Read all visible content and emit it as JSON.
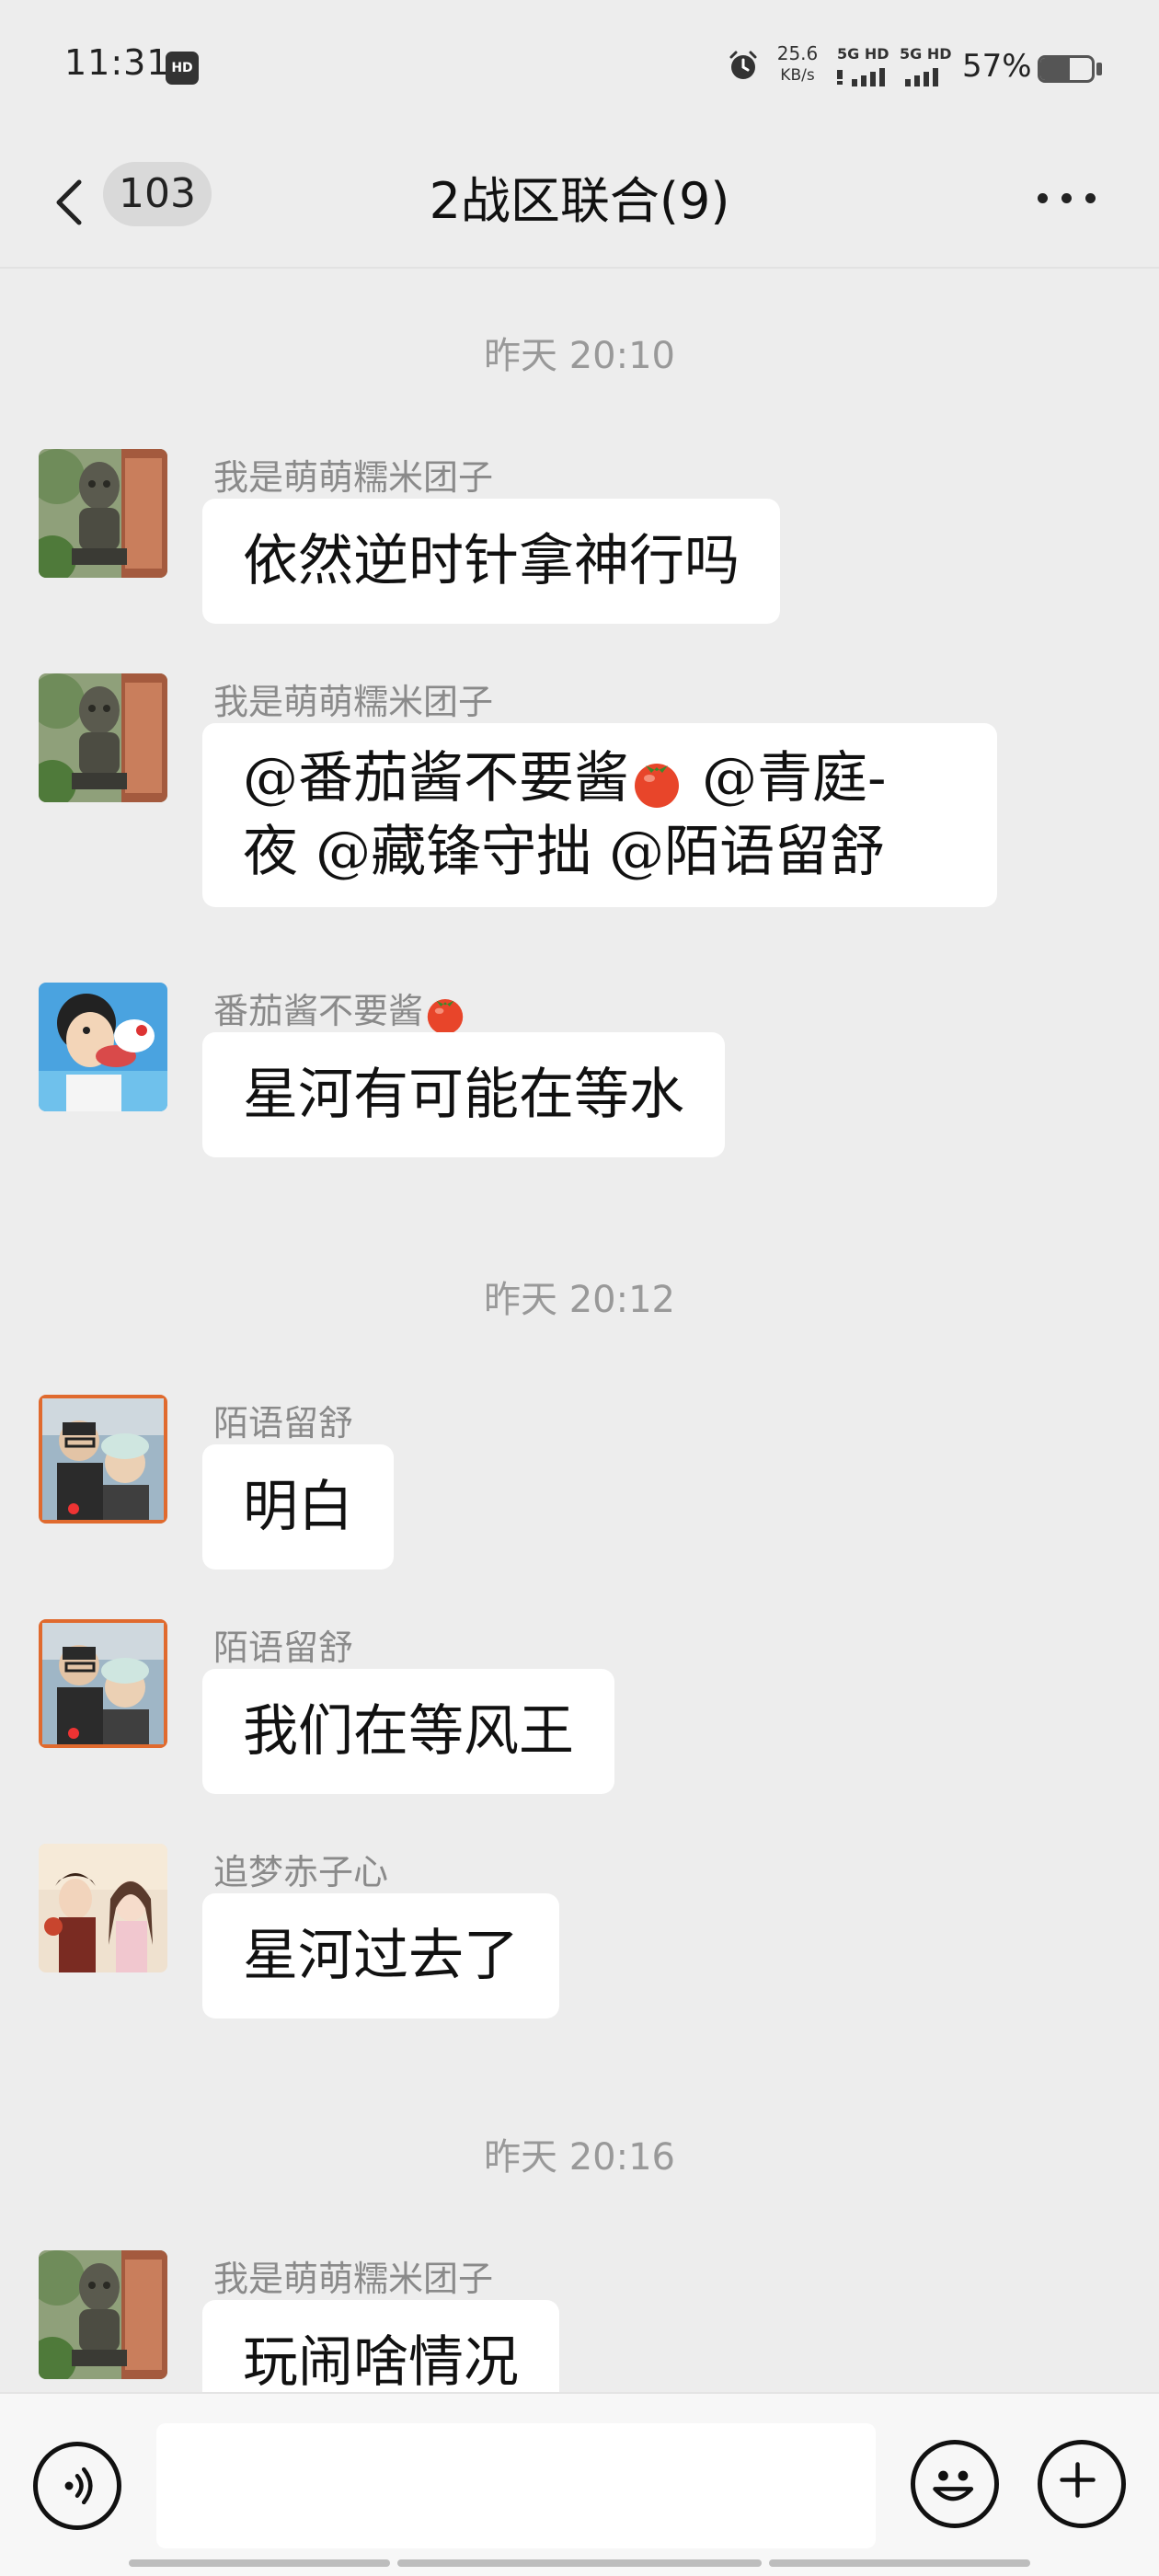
{
  "status_bar": {
    "time": "11:31",
    "net_speed": "25.6",
    "net_unit": "KB/s",
    "sim1": "5G HD",
    "sim2": "5G HD",
    "battery_percent": "57%",
    "battery_level": 0.57
  },
  "header": {
    "unread_count": "103",
    "title": "2战区联合(9)"
  },
  "messages": [
    {
      "type": "time",
      "text": "昨天 20:10"
    },
    {
      "type": "msg",
      "sender": "我是萌萌糯米团子",
      "text": "依然逆时针拿神行吗",
      "avatar": "statue"
    },
    {
      "type": "msg",
      "sender": "我是萌萌糯米团子",
      "line1": "@番茄酱不要酱",
      "line1b": " @青庭-",
      "line2": "夜 @藏锋守拙 @陌语留舒",
      "avatar": "statue"
    },
    {
      "type": "msg",
      "sender": "番茄酱不要酱",
      "text": "星河有可能在等水",
      "avatar": "cartoon"
    },
    {
      "type": "time",
      "text": "昨天 20:12"
    },
    {
      "type": "msg",
      "sender": "陌语留舒",
      "text": "明白",
      "avatar": "couple"
    },
    {
      "type": "msg",
      "sender": "陌语留舒",
      "text": "我们在等风王",
      "avatar": "couple"
    },
    {
      "type": "msg",
      "sender": "追梦赤子心",
      "text": "星河过去了",
      "avatar": "anime"
    },
    {
      "type": "time",
      "text": "昨天 20:16"
    },
    {
      "type": "msg",
      "sender": "我是萌萌糯米团子",
      "text": "玩闹啥情况",
      "avatar": "statue"
    }
  ],
  "input": {
    "placeholder": ""
  },
  "icons": {
    "back": "chevron-left-icon",
    "more": "more-dots-icon",
    "voice": "voice-icon",
    "emoji": "emoji-icon",
    "plus": "plus-icon",
    "tomato": "tomato-emoji-icon"
  }
}
